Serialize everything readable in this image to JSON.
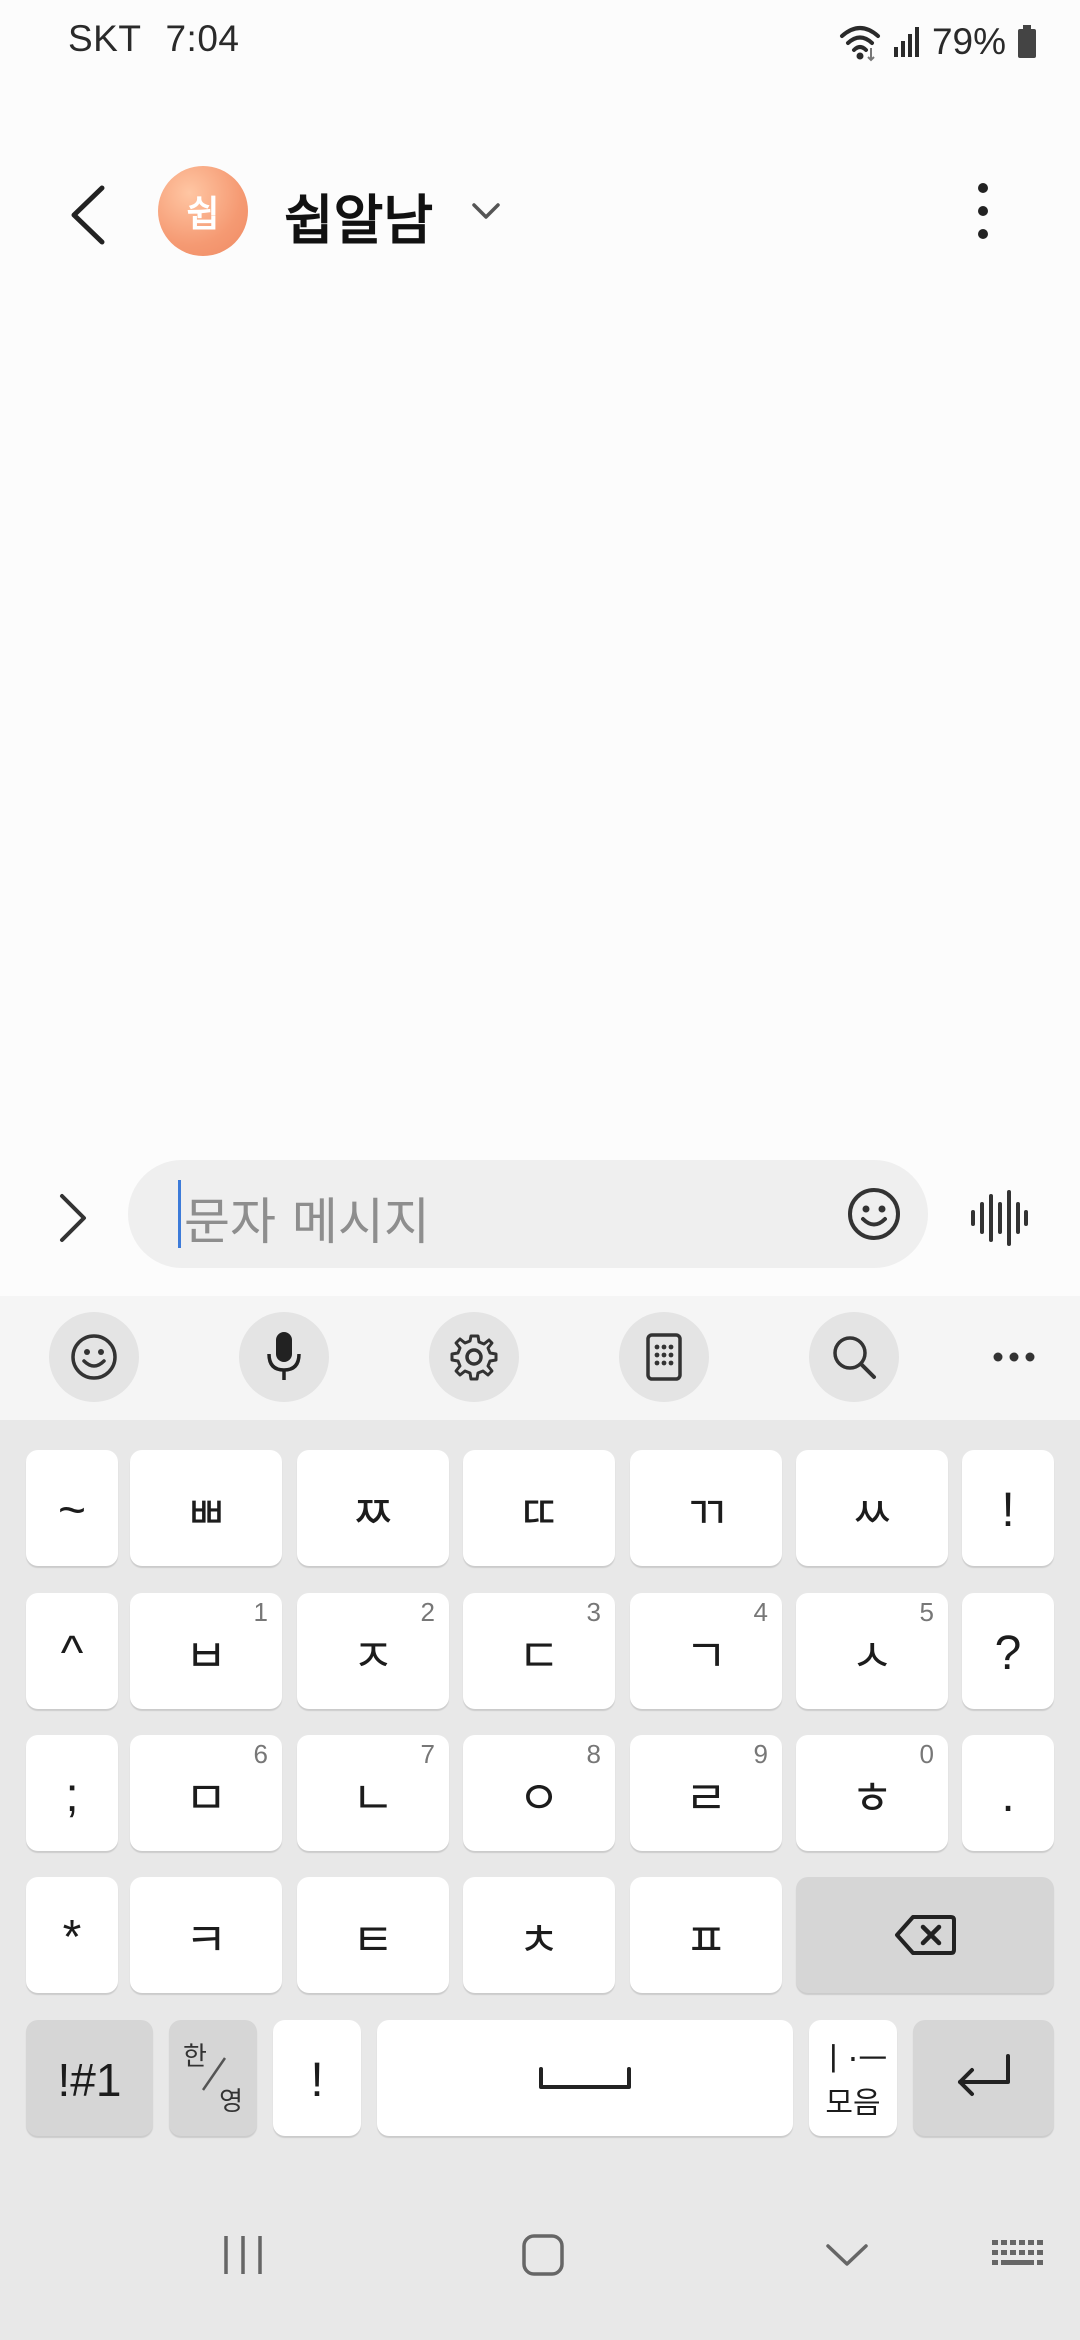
{
  "status_bar": {
    "carrier": "SKT",
    "time": "7:04",
    "battery": "79%"
  },
  "header": {
    "avatar_letter": "쉽",
    "contact_name": "쉽알남"
  },
  "composer": {
    "placeholder": "문자 메시지"
  },
  "keyboard": {
    "rows": [
      [
        {
          "id": "tilde",
          "label": "~"
        },
        {
          "id": "ssbb",
          "label": "ㅃ"
        },
        {
          "id": "ssjj",
          "label": "ㅉ"
        },
        {
          "id": "ssdd",
          "label": "ㄸ"
        },
        {
          "id": "ssgg",
          "label": "ㄲ"
        },
        {
          "id": "ssss",
          "label": "ㅆ"
        },
        {
          "id": "exclaim",
          "label": "!"
        }
      ],
      [
        {
          "id": "caret",
          "label": "^"
        },
        {
          "id": "b",
          "label": "ㅂ",
          "hint": "1"
        },
        {
          "id": "j",
          "label": "ㅈ",
          "hint": "2"
        },
        {
          "id": "d",
          "label": "ㄷ",
          "hint": "3"
        },
        {
          "id": "g",
          "label": "ㄱ",
          "hint": "4"
        },
        {
          "id": "s",
          "label": "ㅅ",
          "hint": "5"
        },
        {
          "id": "question",
          "label": "?"
        }
      ],
      [
        {
          "id": "semicolon",
          "label": ";"
        },
        {
          "id": "m",
          "label": "ㅁ",
          "hint": "6"
        },
        {
          "id": "n",
          "label": "ㄴ",
          "hint": "7"
        },
        {
          "id": "ieung",
          "label": "ㅇ",
          "hint": "8"
        },
        {
          "id": "r",
          "label": "ㄹ",
          "hint": "9"
        },
        {
          "id": "h",
          "label": "ㅎ",
          "hint": "0"
        },
        {
          "id": "period",
          "label": "."
        }
      ],
      [
        {
          "id": "asterisk",
          "label": "*"
        },
        {
          "id": "k",
          "label": "ㅋ"
        },
        {
          "id": "t",
          "label": "ㅌ"
        },
        {
          "id": "ch",
          "label": "ㅊ"
        },
        {
          "id": "p",
          "label": "ㅍ"
        }
      ]
    ],
    "symbols_key": "!#1",
    "lang_key_top": "한",
    "lang_key_bottom": "영",
    "exclaim_key": "!",
    "vowel_key_top": "ㅣ·ㅡ",
    "vowel_key_bottom": "모음"
  }
}
